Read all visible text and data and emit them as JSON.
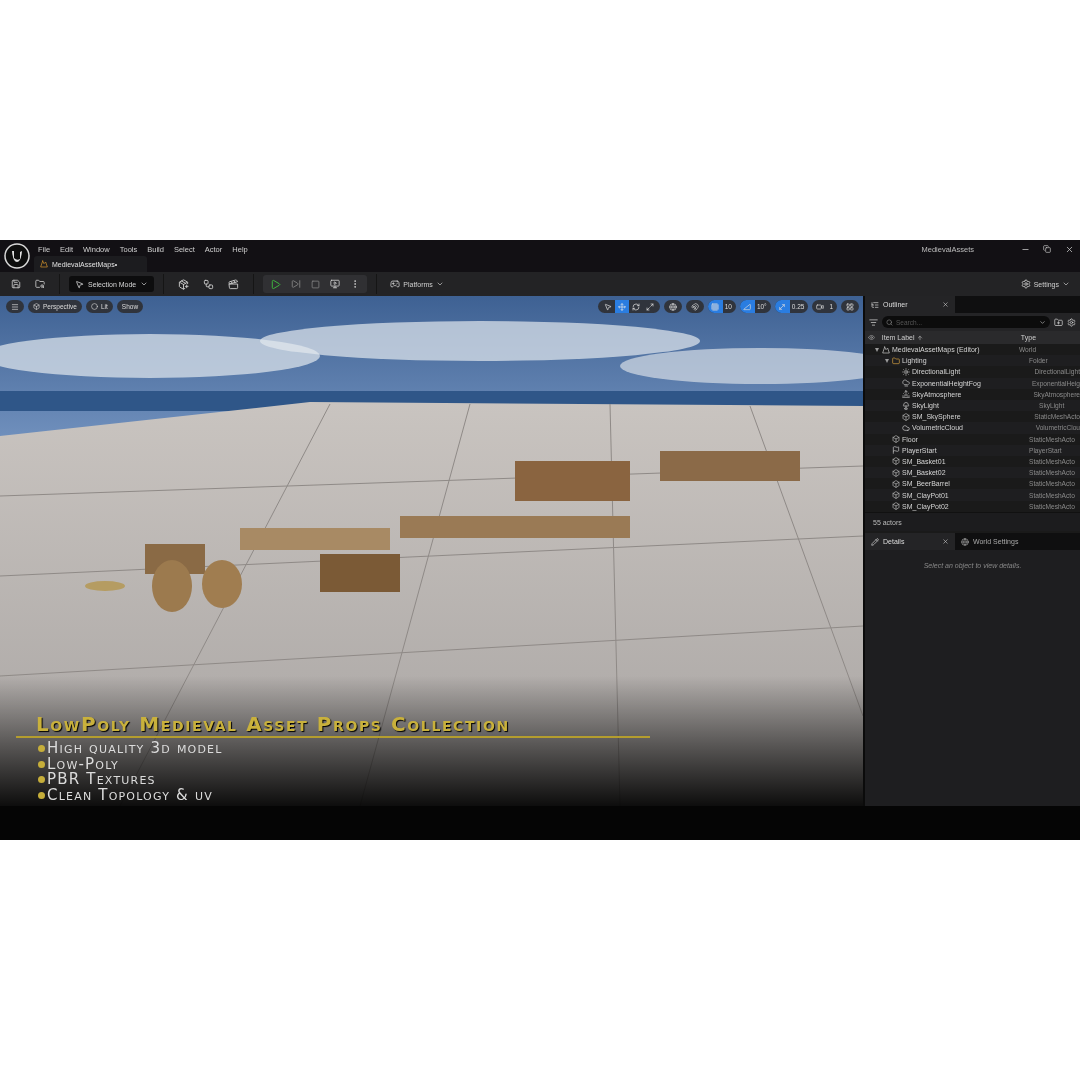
{
  "window": {
    "title": "MedievalAssets"
  },
  "menu": [
    "File",
    "Edit",
    "Window",
    "Tools",
    "Build",
    "Select",
    "Actor",
    "Help"
  ],
  "document_tab": {
    "label": "MedievalAssetMaps•"
  },
  "toolbar": {
    "mode": "Selection Mode",
    "platforms": "Platforms",
    "settings": "Settings"
  },
  "viewport": {
    "view_buttons": [
      "Perspective",
      "Lit",
      "Show"
    ],
    "transform_tools": [
      {
        "kind": "select",
        "selected": false
      },
      {
        "kind": "move",
        "selected": true
      },
      {
        "kind": "rotate",
        "selected": false
      },
      {
        "kind": "scale",
        "selected": false
      }
    ],
    "snaps": [
      {
        "kind": "grid",
        "value": "10",
        "on": true
      },
      {
        "kind": "angle",
        "value": "10°",
        "on": true
      },
      {
        "kind": "scale",
        "value": "0.25",
        "on": true
      },
      {
        "kind": "camera",
        "value": "1",
        "on": false
      }
    ],
    "overlay": {
      "title": "LowPoly Medieval Asset Props Collection",
      "bullets": [
        "High quality 3d model",
        "Low-Poly",
        "PBR Textures",
        "Clean Topology & uv"
      ]
    }
  },
  "outliner": {
    "tab": "Outliner",
    "search": {
      "placeholder": "Search..."
    },
    "columns": [
      "Item Label",
      "Type"
    ],
    "tree": [
      {
        "label": "MedievalAssetMaps (Editor)",
        "type": "World",
        "kind": "world",
        "expanded": true,
        "children": [
          {
            "label": "Lighting",
            "type": "Folder",
            "kind": "folder",
            "expanded": true,
            "children": [
              {
                "label": "DirectionalLight",
                "type": "DirectionalLight",
                "kind": "light"
              },
              {
                "label": "ExponentialHeightFog",
                "type": "ExponentialHeig",
                "kind": "fog"
              },
              {
                "label": "SkyAtmosphere",
                "type": "SkyAtmosphere",
                "kind": "atmosphere"
              },
              {
                "label": "SkyLight",
                "type": "SkyLight",
                "kind": "skylight"
              },
              {
                "label": "SM_SkySphere",
                "type": "StaticMeshActo",
                "kind": "mesh"
              },
              {
                "label": "VolumetricCloud",
                "type": "VolumetricClou",
                "kind": "cloud"
              }
            ]
          },
          {
            "label": "Floor",
            "type": "StaticMeshActo",
            "kind": "mesh"
          },
          {
            "label": "PlayerStart",
            "type": "PlayerStart",
            "kind": "player"
          },
          {
            "label": "SM_Basket01",
            "type": "StaticMeshActo",
            "kind": "mesh"
          },
          {
            "label": "SM_Basket02",
            "type": "StaticMeshActo",
            "kind": "mesh"
          },
          {
            "label": "SM_BeerBarrel",
            "type": "StaticMeshActo",
            "kind": "mesh"
          },
          {
            "label": "SM_ClayPot01",
            "type": "StaticMeshActo",
            "kind": "mesh"
          },
          {
            "label": "SM_ClayPot02",
            "type": "StaticMeshActo",
            "kind": "mesh"
          }
        ]
      }
    ],
    "footer": "55 actors"
  },
  "details": {
    "tabs": [
      {
        "label": "Details",
        "kind": "details",
        "selected": true
      },
      {
        "label": "World Settings",
        "kind": "world",
        "selected": false
      }
    ],
    "empty_message": "Select an object to view details."
  }
}
